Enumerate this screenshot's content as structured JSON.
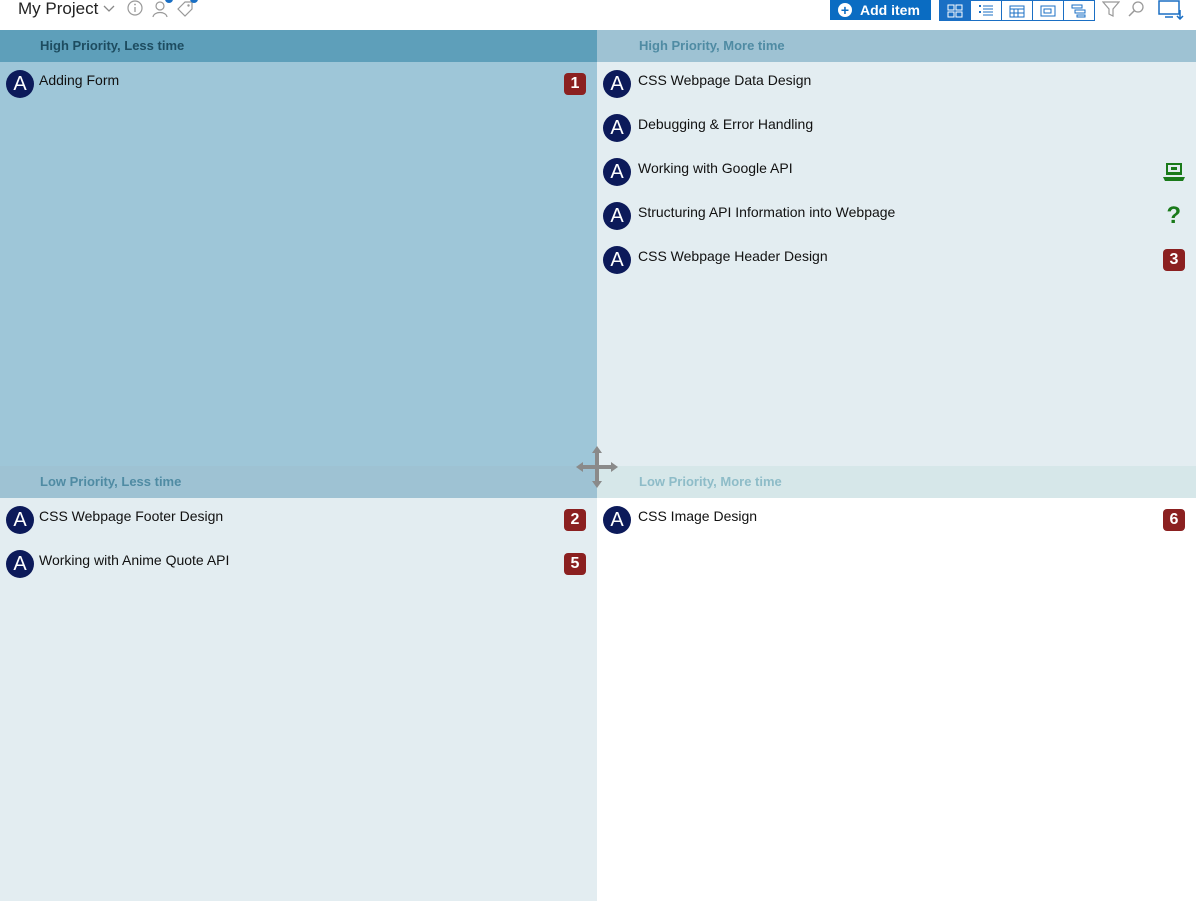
{
  "header": {
    "project_title": "My Project",
    "add_item_label": "Add item"
  },
  "colors": {
    "accent": "#0a6cc2",
    "avatar": "#0c1a5a",
    "badge": "#8b2020",
    "icon_green": "#1a7a1a"
  },
  "quadrants": [
    {
      "title": "High Priority, Less time",
      "items": [
        {
          "avatar": "A",
          "title": "Adding Form",
          "badge": "1"
        }
      ]
    },
    {
      "title": "High Priority, More time",
      "items": [
        {
          "avatar": "A",
          "title": "CSS Webpage Data Design"
        },
        {
          "avatar": "A",
          "title": "Debugging & Error Handling"
        },
        {
          "avatar": "A",
          "title": "Working with Google API",
          "icon": "laptop-icon"
        },
        {
          "avatar": "A",
          "title": "Structuring API Information into Webpage",
          "icon": "question-icon"
        },
        {
          "avatar": "A",
          "title": "CSS Webpage Header Design",
          "badge": "3"
        }
      ]
    },
    {
      "title": "Low Priority, Less time",
      "items": [
        {
          "avatar": "A",
          "title": "CSS Webpage Footer Design",
          "badge": "2"
        },
        {
          "avatar": "A",
          "title": "Working with Anime Quote API",
          "badge": "5"
        }
      ]
    },
    {
      "title": "Low Priority, More time",
      "items": [
        {
          "avatar": "A",
          "title": "CSS Image Design",
          "badge": "6"
        }
      ]
    }
  ]
}
